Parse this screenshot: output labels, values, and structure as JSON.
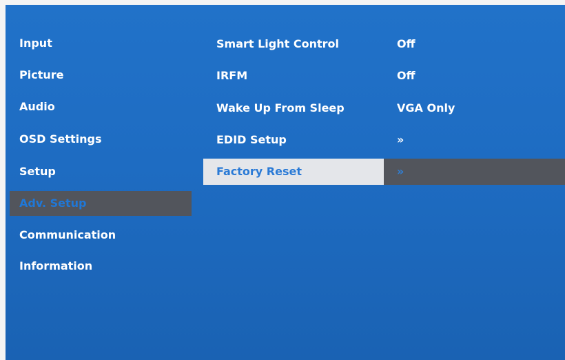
{
  "menu": {
    "items": [
      {
        "label": "Input",
        "selected": false
      },
      {
        "label": "Picture",
        "selected": false
      },
      {
        "label": "Audio",
        "selected": false
      },
      {
        "label": "OSD Settings",
        "selected": false
      },
      {
        "label": "Setup",
        "selected": false
      },
      {
        "label": "Adv. Setup",
        "selected": true
      },
      {
        "label": "Communication",
        "selected": false
      },
      {
        "label": "Information",
        "selected": false
      }
    ]
  },
  "settings": {
    "rows": [
      {
        "label": "Smart Light Control",
        "value": "Off",
        "highlighted": false
      },
      {
        "label": "IRFM",
        "value": "Off",
        "highlighted": false
      },
      {
        "label": "Wake Up From Sleep",
        "value": "VGA Only",
        "highlighted": false
      },
      {
        "label": "EDID Setup",
        "value": "»",
        "highlighted": false
      },
      {
        "label": "Factory Reset",
        "value": "»",
        "highlighted": true
      }
    ]
  },
  "colors": {
    "background": "#1e6cc2",
    "selected_bg": "#52555c",
    "highlight_label_bg": "#e4e6ea",
    "text": "#ffffff",
    "selected_text": "#1f78d8"
  }
}
